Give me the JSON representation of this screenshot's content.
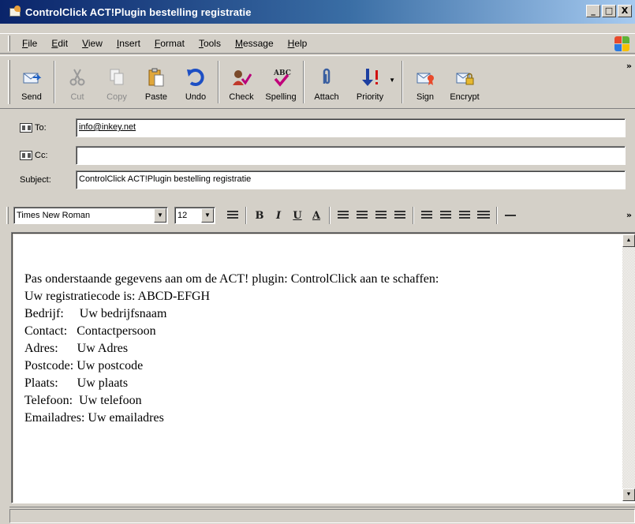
{
  "window": {
    "title": "ControlClick ACT!Plugin bestelling registratie",
    "min": "_",
    "max": "□",
    "close": "X"
  },
  "menu": [
    "File",
    "Edit",
    "View",
    "Insert",
    "Format",
    "Tools",
    "Message",
    "Help"
  ],
  "toolbar": {
    "send": "Send",
    "cut": "Cut",
    "copy": "Copy",
    "paste": "Paste",
    "undo": "Undo",
    "check": "Check",
    "spelling": "Spelling",
    "attach": "Attach",
    "priority": "Priority",
    "sign": "Sign",
    "encrypt": "Encrypt",
    "more": "»"
  },
  "header": {
    "to_label": "To:",
    "to_value": "info@inkey.net",
    "cc_label": "Cc:",
    "cc_value": "",
    "subject_label": "Subject:",
    "subject_value": "ControlClick ACT!Plugin bestelling registratie"
  },
  "format": {
    "font": "Times New Roman",
    "size": "12",
    "bold": "B",
    "italic": "I",
    "underline": "U",
    "color": "A",
    "more": "»"
  },
  "body": {
    "intro": "Pas onderstaande gegevens aan om de ACT! plugin: ControlClick aan te schaffen:",
    "reg": "Uw registratiecode is: ABCD-EFGH",
    "bedrijf": "Bedrijf:     Uw bedrijfsnaam",
    "contact": "Contact:   Contactpersoon",
    "adres": "Adres:      Uw Adres",
    "postcode": "Postcode: Uw postcode",
    "plaats": "Plaats:      Uw plaats",
    "telefoon": "Telefoon:  Uw telefoon",
    "email": "Emailadres: Uw emailadres"
  },
  "colors": {
    "title_start": "#0a246a",
    "title_end": "#a6caf0",
    "chrome": "#d4d0c8"
  }
}
